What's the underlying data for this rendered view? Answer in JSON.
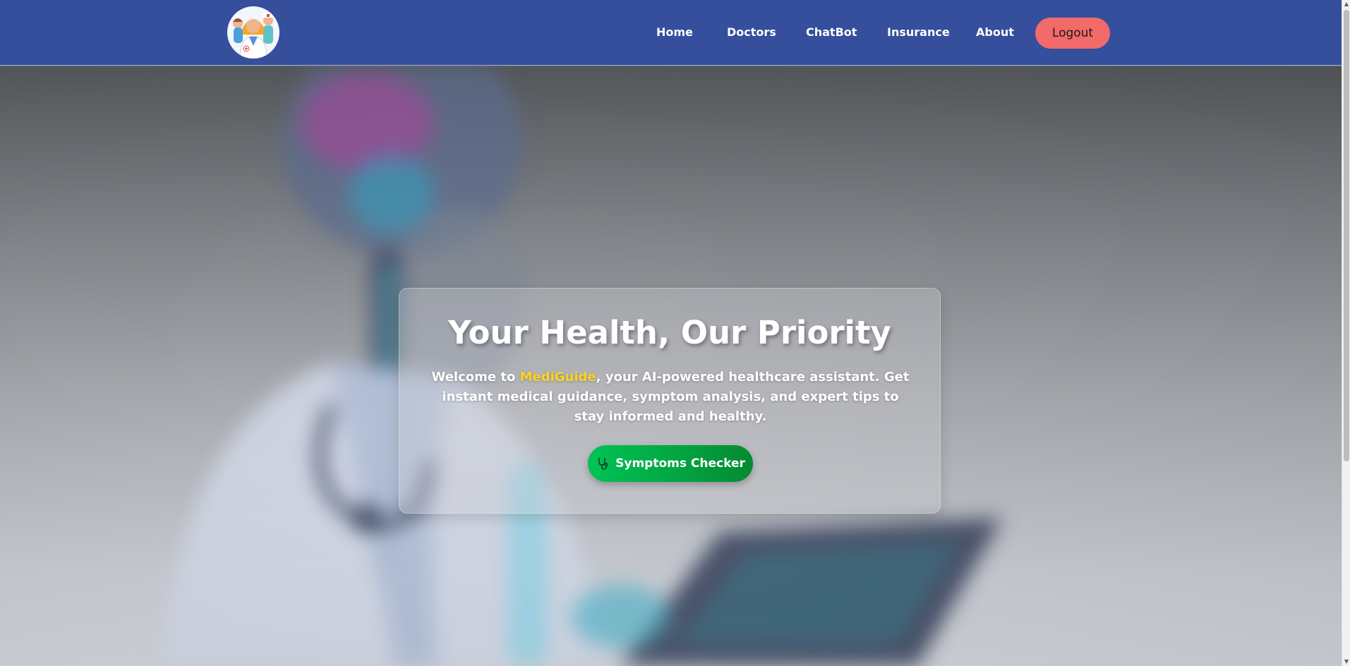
{
  "nav": {
    "logo_icon": "doctors-avatar-logo",
    "links": [
      {
        "label": "Home"
      },
      {
        "label": "Doctors"
      },
      {
        "label": "ChatBot"
      },
      {
        "label": "Insurance"
      },
      {
        "label": "About"
      }
    ],
    "logout_label": "Logout"
  },
  "hero": {
    "title": "Your Health, Our Priority",
    "text_before": "Welcome to ",
    "brand": "MediGuide",
    "text_after": ", your AI-powered healthcare assistant. Get instant medical guidance, symptom analysis, and expert tips to stay informed and healthy.",
    "cta_label": "Symptoms Checker",
    "cta_icon": "stethoscope-icon"
  },
  "colors": {
    "navbar": "#354f9c",
    "logout": "#f36a6a",
    "brand": "#ffd21f",
    "cta_start": "#00c455",
    "cta_end": "#058a32"
  }
}
